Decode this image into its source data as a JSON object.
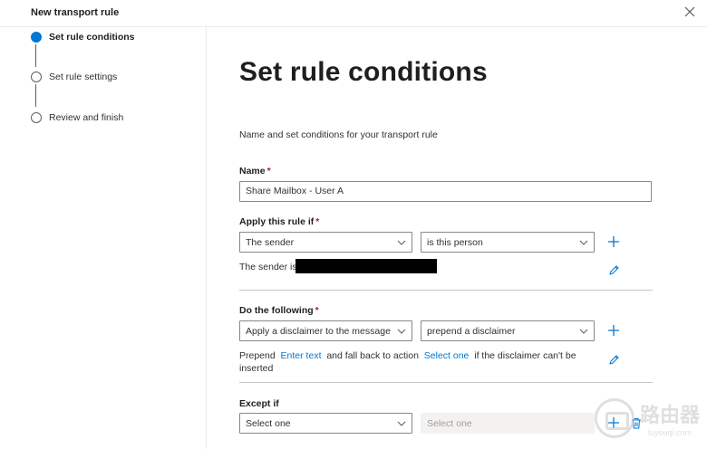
{
  "panel": {
    "title": "New transport rule"
  },
  "steps": [
    {
      "label": "Set rule conditions",
      "active": true
    },
    {
      "label": "Set rule settings",
      "active": false
    },
    {
      "label": "Review and finish",
      "active": false
    }
  ],
  "main": {
    "heading": "Set rule conditions",
    "description": "Name and set conditions for your transport rule",
    "name": {
      "label": "Name",
      "required": "*",
      "value": "Share Mailbox - User A"
    },
    "apply": {
      "label": "Apply this rule if",
      "required": "*",
      "condition": "The sender",
      "operator": "is this person",
      "summary_prefix": "The sender is"
    },
    "do": {
      "label": "Do the following",
      "required": "*",
      "action": "Apply a disclaimer to the message",
      "sub_action": "prepend a disclaimer",
      "text_prepend": "Prepend",
      "link_enter_text": "Enter text",
      "text_fallback": "and fall back to action",
      "link_select_one": "Select one",
      "text_suffix": "if the disclaimer can't be inserted"
    },
    "except": {
      "label": "Except if",
      "select": "Select one",
      "select_disabled": "Select one"
    }
  },
  "watermark": {
    "big": "路由器",
    "small": "luyouqi.com"
  },
  "colors": {
    "accent": "#0078d4",
    "required": "#a4262c",
    "border": "#8a8886"
  },
  "icons": [
    "close-icon",
    "chevron-down-icon",
    "add-icon",
    "edit-icon",
    "delete-icon"
  ]
}
